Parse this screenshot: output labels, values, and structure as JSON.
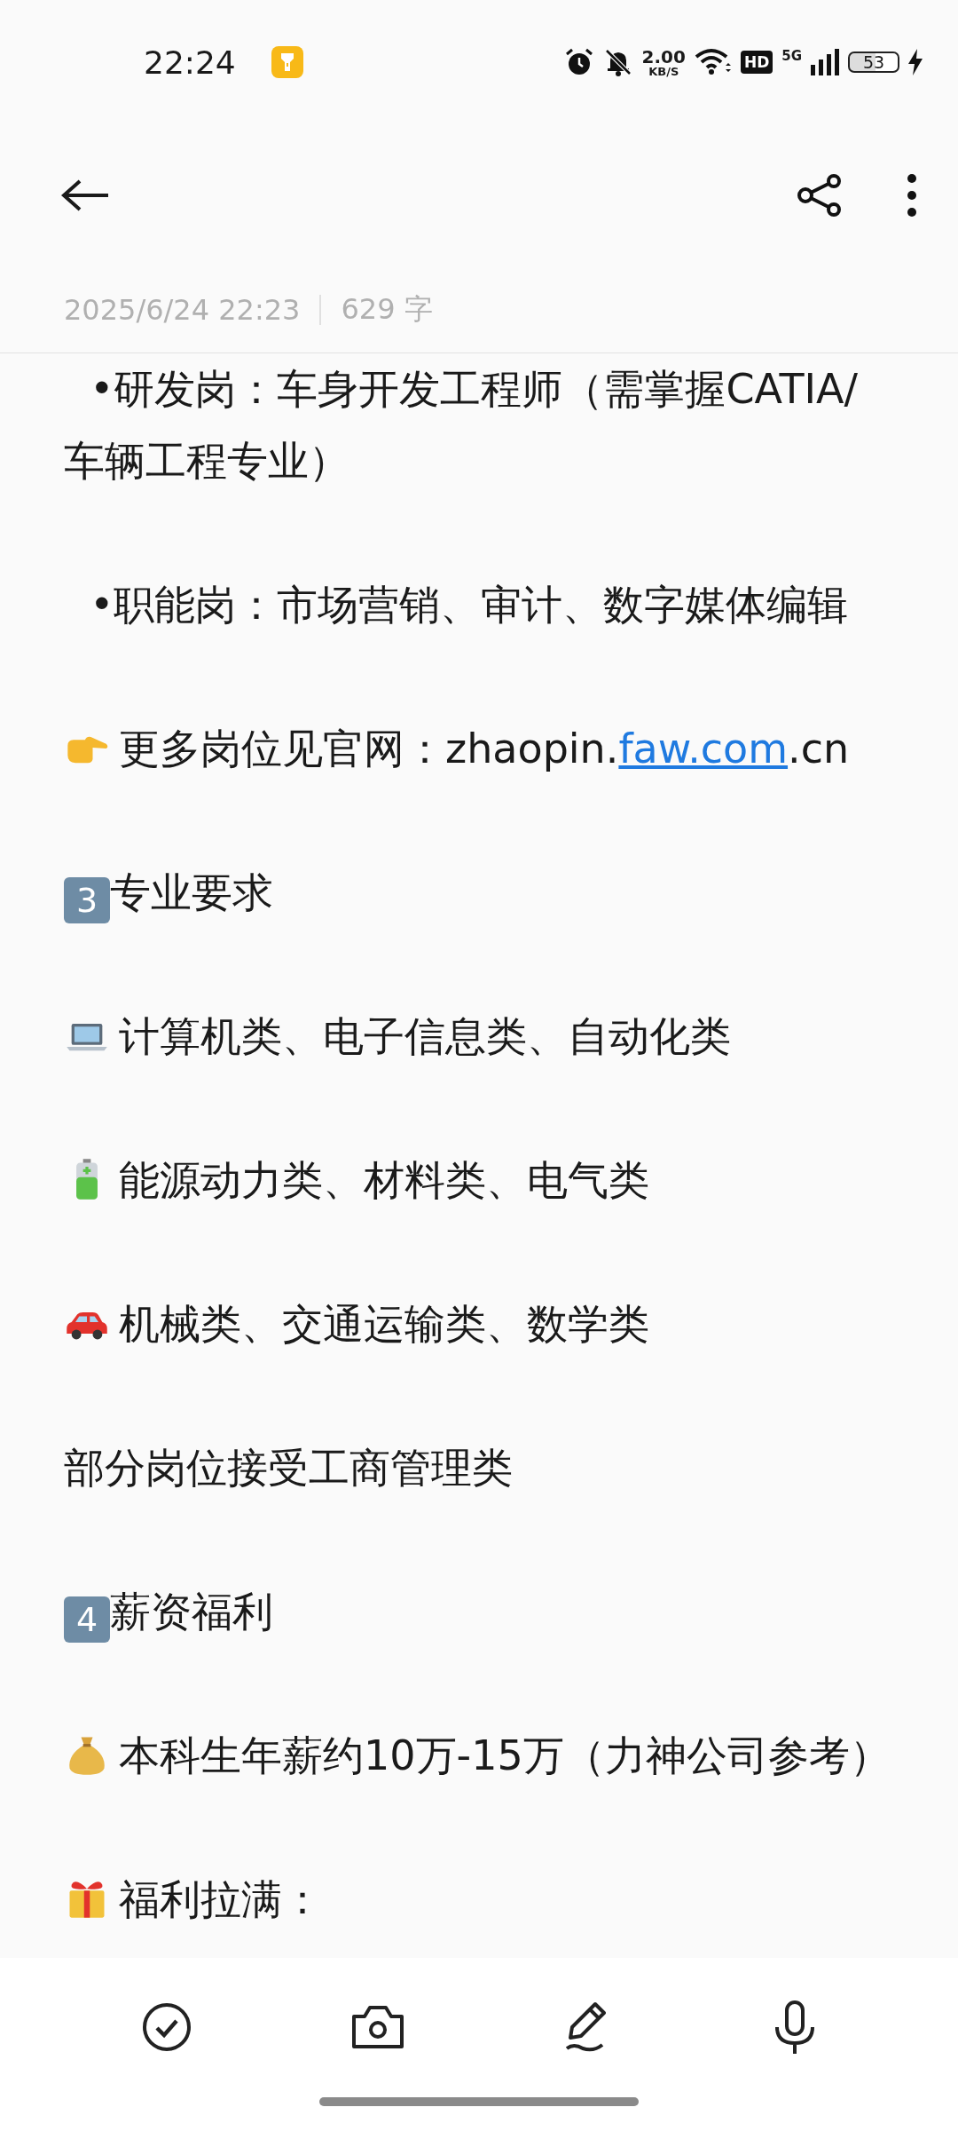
{
  "status_bar": {
    "time": "22:24",
    "net_speed": "2.00",
    "net_unit": "KB/S",
    "hd_label": "HD",
    "network": "5G",
    "battery": "53"
  },
  "meta": {
    "date": "2025/6/24 22:23",
    "word_count": "629 字"
  },
  "paragraphs": [
    {
      "text": "  •研发岗：车身开发工程师（需掌握CATIA/车辆工程专业）"
    },
    {
      "text": "  •职能岗：市场营销、审计、数字媒体编辑"
    },
    {
      "kind": "hand",
      "parts": [
        {
          "text": "更多岗位见官网：zhaopin."
        },
        {
          "text": "faw.com",
          "link": true
        },
        {
          "text": ".cn"
        }
      ]
    },
    {
      "keycap": "3",
      "text": "专业要求"
    },
    {
      "kind": "laptop",
      "text": "计算机类、电子信息类、自动化类"
    },
    {
      "kind": "battery",
      "text": "能源动力类、材料类、电气类"
    },
    {
      "kind": "car",
      "text": "机械类、交通运输类、数学类"
    },
    {
      "text": "部分岗位接受工商管理类"
    },
    {
      "keycap": "4",
      "text": "薪资福利"
    },
    {
      "kind": "moneybag",
      "text": "本科生年薪约10万-15万（力神公司参考）"
    },
    {
      "kind": "gift",
      "text": "福利拉满："
    }
  ]
}
